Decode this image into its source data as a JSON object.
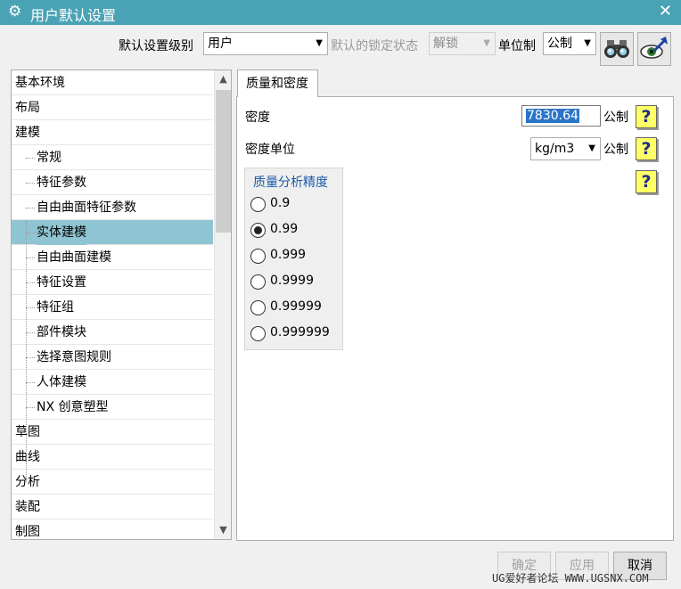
{
  "window": {
    "title": "用户默认设置",
    "close_label": "✕"
  },
  "toolbar": {
    "level_label": "默认设置级别",
    "level_value": "用户",
    "lock_label": "默认的锁定状态",
    "lock_value": "解锁",
    "unit_label": "单位制",
    "unit_value": "公制",
    "icons": [
      "binoculars-icon",
      "eye-arrow-icon"
    ]
  },
  "tree": {
    "items": [
      {
        "label": "基本环境",
        "level": 0
      },
      {
        "label": "布局",
        "level": 0
      },
      {
        "label": "建模",
        "level": 0
      },
      {
        "label": "常规",
        "level": 1
      },
      {
        "label": "特征参数",
        "level": 1
      },
      {
        "label": "自由曲面特征参数",
        "level": 1
      },
      {
        "label": "实体建模",
        "level": 1,
        "selected": true
      },
      {
        "label": "自由曲面建模",
        "level": 1
      },
      {
        "label": "特征设置",
        "level": 1
      },
      {
        "label": "特征组",
        "level": 1
      },
      {
        "label": "部件模块",
        "level": 1
      },
      {
        "label": "选择意图规则",
        "level": 1
      },
      {
        "label": "人体建模",
        "level": 1
      },
      {
        "label": "NX 创意塑型",
        "level": 1
      },
      {
        "label": "草图",
        "level": 0
      },
      {
        "label": "曲线",
        "level": 0
      },
      {
        "label": "分析",
        "level": 0
      },
      {
        "label": "装配",
        "level": 0
      },
      {
        "label": "制图",
        "level": 0
      }
    ]
  },
  "tab": {
    "label": "质量和密度"
  },
  "density": {
    "label": "密度",
    "value": "7830.64",
    "unit": "公制",
    "help": "?"
  },
  "density_unit": {
    "label": "密度单位",
    "value": "kg/m3",
    "unit": "公制",
    "help": "?"
  },
  "precision": {
    "title": "质量分析精度",
    "help": "?",
    "options": [
      "0.9",
      "0.99",
      "0.999",
      "0.9999",
      "0.99999",
      "0.999999"
    ],
    "selected": "0.99"
  },
  "buttons": {
    "ok": "确定",
    "apply": "应用",
    "cancel": "取消"
  },
  "watermark": "UG爱好者论坛 WWW.UGSNX.COM",
  "colors": {
    "titlebar": "#4aa3b5",
    "selected_row": "#8fc5d2",
    "help_bg": "#ffff66"
  }
}
